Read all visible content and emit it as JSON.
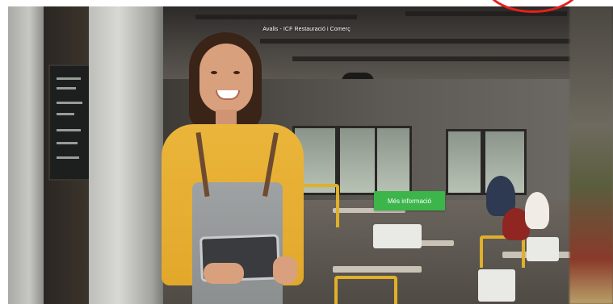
{
  "hero": {
    "title": "Avalis - ICF Restauració i Comerç",
    "cta_label": "Més informació",
    "image_subject": "waitress-holding-tablet"
  },
  "colors": {
    "cta_background": "#3cb54a",
    "cta_text": "#ffffff",
    "title_text": "#ffffff",
    "annotation": "#e8201c"
  },
  "icons": {
    "annotation": "red-circle-annotation"
  }
}
